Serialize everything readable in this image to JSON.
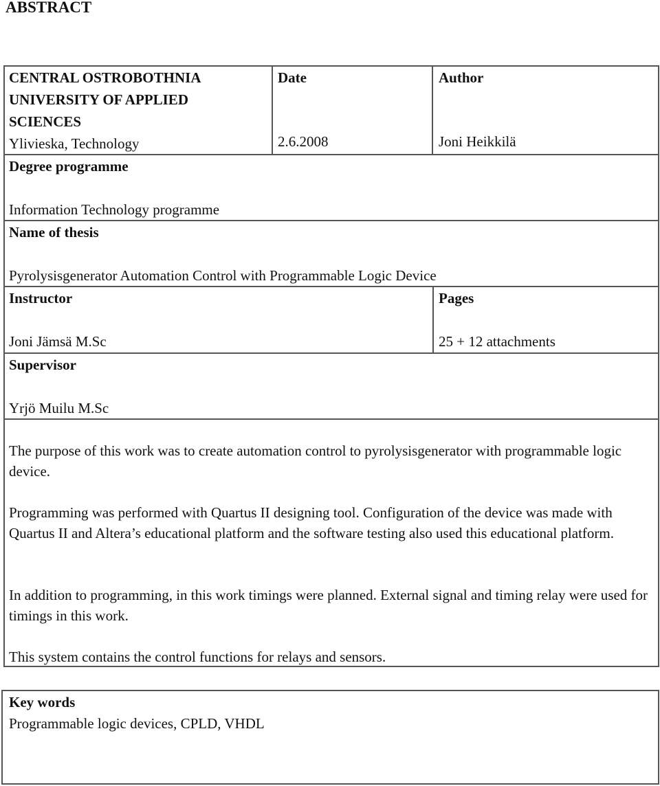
{
  "document": {
    "title": "ABSTRACT",
    "institution": {
      "name_lines": [
        "CENTRAL OSTROBOTHNIA",
        "UNIVERSITY OF APPLIED",
        "SCIENCES"
      ],
      "unit": "Ylivieska, Technology"
    },
    "date": {
      "label": "Date",
      "value": "2.6.2008"
    },
    "author": {
      "label": "Author",
      "value": "Joni Heikkilä"
    },
    "degree_programme": {
      "label": "Degree programme",
      "value": "Information Technology programme"
    },
    "thesis_name": {
      "label": "Name of thesis",
      "value": "Pyrolysisgenerator Automation Control with Programmable Logic Device"
    },
    "instructor": {
      "label": "Instructor",
      "value": "Joni Jämsä M.Sc"
    },
    "pages": {
      "label": "Pages",
      "value": "25 + 12 attachments"
    },
    "supervisor": {
      "label": "Supervisor",
      "value": "Yrjö Muilu M.Sc"
    },
    "abstract_paragraphs": [
      "The purpose of this work was to create automation control to pyrolysisgenerator with programmable logic device.",
      "Programming was performed with Quartus II designing tool. Configuration of the device was made with Quartus II and Altera’s educational platform and the software testing also used this educational platform.",
      "In addition to programming, in this work timings were planned. External signal and timing relay were used for timings in this work.",
      "This system contains the control functions for relays and sensors."
    ],
    "keywords": {
      "label": "Key words",
      "value": "Programmable logic devices, CPLD, VHDL"
    }
  }
}
